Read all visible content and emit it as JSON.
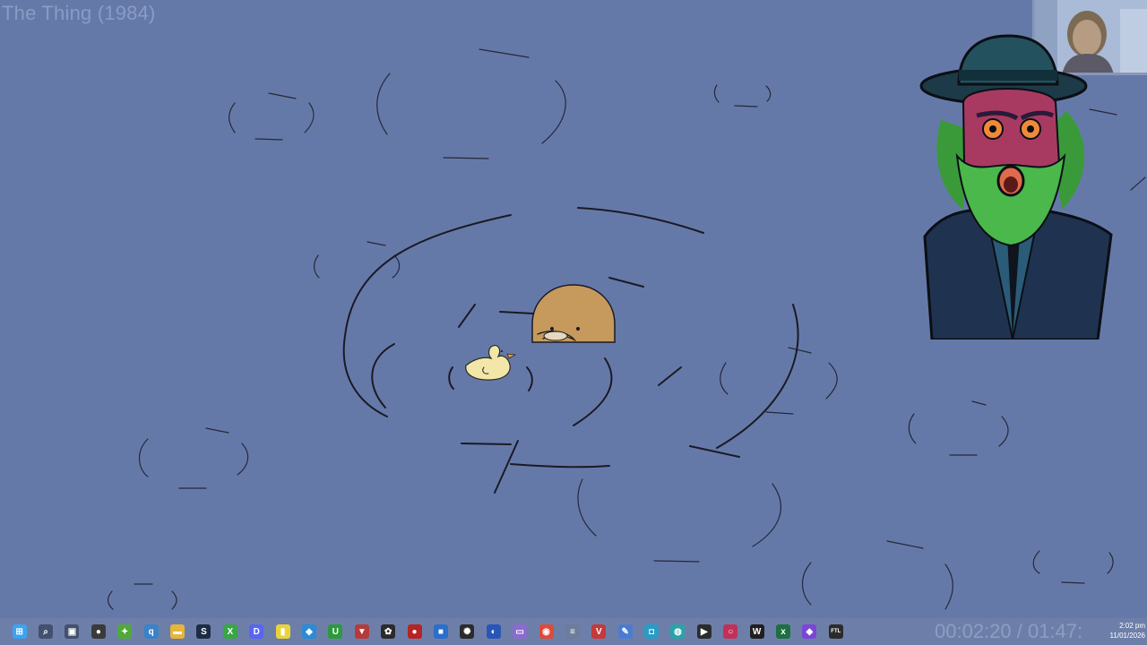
{
  "video": {
    "title": "The Thing (1984)",
    "timecode": "00:02:20 / 01:47:"
  },
  "colors": {
    "background": "#6579a9",
    "ink": "#1a1a24",
    "potato": "#c59a5c",
    "duck": "#f2e7a8",
    "taskbar": "#6d7fa9"
  },
  "taskbar": {
    "icons": [
      {
        "name": "windows-start-icon",
        "color": "#3da2f0",
        "glyph": "⊞"
      },
      {
        "name": "search-icon",
        "color": "#44516e",
        "glyph": "⌕"
      },
      {
        "name": "task-view-icon",
        "color": "#44516e",
        "glyph": "▣"
      },
      {
        "name": "obs-icon",
        "color": "#3a3a3a",
        "glyph": "●"
      },
      {
        "name": "xbox-app-icon",
        "color": "#52a83a",
        "glyph": "✦"
      },
      {
        "name": "qbittorrent-icon",
        "color": "#3b82c8",
        "glyph": "q"
      },
      {
        "name": "file-explorer-icon",
        "color": "#e6b53a",
        "glyph": "▬"
      },
      {
        "name": "steam-icon",
        "color": "#1d2b44",
        "glyph": "S"
      },
      {
        "name": "xbox-icon",
        "color": "#3aa545",
        "glyph": "X"
      },
      {
        "name": "discord-icon",
        "color": "#5865f2",
        "glyph": "D"
      },
      {
        "name": "sticky-notes-icon",
        "color": "#e8d43a",
        "glyph": "▮"
      },
      {
        "name": "vscode-icon",
        "color": "#2a8bd6",
        "glyph": "◆"
      },
      {
        "name": "upwork-icon",
        "color": "#2c9a3c",
        "glyph": "U"
      },
      {
        "name": "game-launcher-icon",
        "color": "#b73a3a",
        "glyph": "▼"
      },
      {
        "name": "chatgpt-icon",
        "color": "#2b2b2b",
        "glyph": "✿"
      },
      {
        "name": "app-red-circle-icon",
        "color": "#b52525",
        "glyph": "●"
      },
      {
        "name": "app-blue-square-icon",
        "color": "#2a6fc9",
        "glyph": "■"
      },
      {
        "name": "davinci-resolve-icon",
        "color": "#2b2b2b",
        "glyph": "✺"
      },
      {
        "name": "epic-app-icon",
        "color": "#2a55b8",
        "glyph": "◐"
      },
      {
        "name": "app-purple-icon",
        "color": "#8a6bd0",
        "glyph": "▭"
      },
      {
        "name": "chrome-icon",
        "color": "#dd4a3a",
        "glyph": "◉"
      },
      {
        "name": "database-icon",
        "color": "#6b7d9a",
        "glyph": "≡"
      },
      {
        "name": "voicemeeter-icon",
        "color": "#c43a3a",
        "glyph": "V"
      },
      {
        "name": "notepad-icon",
        "color": "#4a7bd3",
        "glyph": "✎"
      },
      {
        "name": "screen-capture-icon",
        "color": "#2a9bc4",
        "glyph": "◘"
      },
      {
        "name": "browser-globe-icon",
        "color": "#2aa3a8",
        "glyph": "◍"
      },
      {
        "name": "media-player-icon",
        "color": "#2b2b2b",
        "glyph": "▶"
      },
      {
        "name": "app-ring-icon",
        "color": "#c2305a",
        "glyph": "○"
      },
      {
        "name": "wps-icon",
        "color": "#1f1f1f",
        "glyph": "W"
      },
      {
        "name": "excel-icon",
        "color": "#1d6f42",
        "glyph": "x"
      },
      {
        "name": "app-violet-icon",
        "color": "#7b45d6",
        "glyph": "◆"
      },
      {
        "name": "ftl-icon",
        "color": "#2b2b2b",
        "glyph": "FTL"
      }
    ]
  },
  "clock": {
    "time": "2:02 pm",
    "date": "11/01/2026"
  }
}
